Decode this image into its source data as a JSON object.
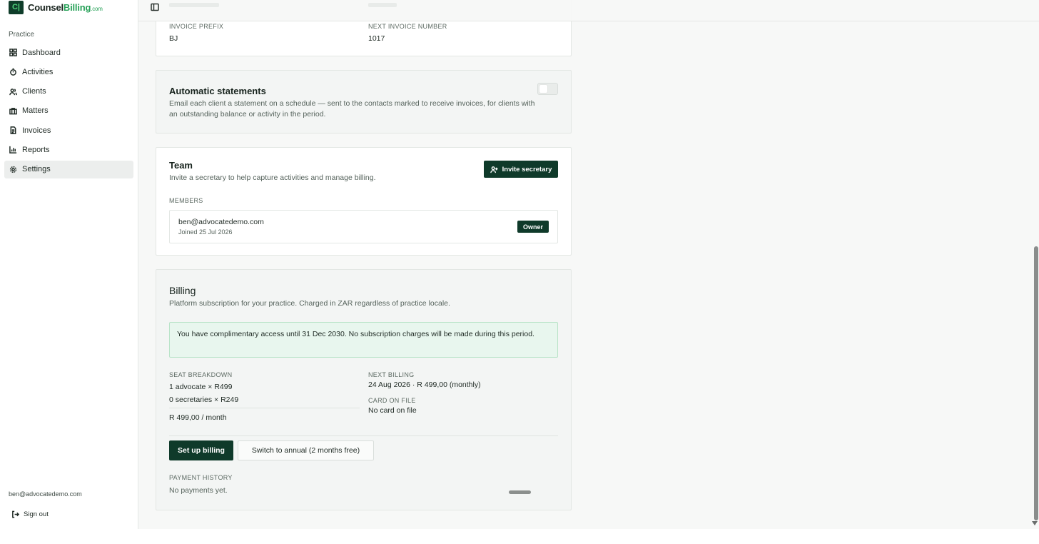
{
  "brand": {
    "logo": "C|",
    "name_main": "Counsel",
    "name_accent": "Billing",
    "name_domain": ".com"
  },
  "sidebar": {
    "section_label": "Practice",
    "items": [
      {
        "label": "Dashboard",
        "icon": "grid-icon"
      },
      {
        "label": "Activities",
        "icon": "timer-icon"
      },
      {
        "label": "Clients",
        "icon": "users-icon"
      },
      {
        "label": "Matters",
        "icon": "briefcase-icon"
      },
      {
        "label": "Invoices",
        "icon": "file-text-icon"
      },
      {
        "label": "Reports",
        "icon": "bar-chart-icon"
      },
      {
        "label": "Settings",
        "icon": "gear-icon"
      }
    ],
    "active": "Settings",
    "user_email": "ben@advocatedemo.com",
    "sign_out": "Sign out"
  },
  "invoice_settings": {
    "prefix_label": "INVOICE PREFIX",
    "prefix_value": "BJ",
    "next_number_label": "NEXT INVOICE NUMBER",
    "next_number_value": "1017"
  },
  "statements": {
    "title": "Automatic statements",
    "description": "Email each client a statement on a schedule — sent to the contacts marked to receive invoices, for clients with an outstanding balance or activity in the period.",
    "enabled": false
  },
  "team": {
    "title": "Team",
    "subtitle": "Invite a secretary to help capture activities and manage billing.",
    "invite_button": "Invite secretary",
    "members_label": "MEMBERS",
    "members": [
      {
        "email": "ben@advocatedemo.com",
        "joined": "Joined 25 Jul 2026",
        "role": "Owner"
      }
    ]
  },
  "billing": {
    "title": "Billing",
    "subtitle": "Platform subscription for your practice. Charged in ZAR regardless of practice locale.",
    "notice": "You have complimentary access until 31 Dec 2030. No subscription charges will be made during this period.",
    "seat_label": "SEAT BREAKDOWN",
    "seat_lines": [
      "1 advocate × R499",
      "0 secretaries × R249"
    ],
    "seat_total": "R 499,00 / month",
    "next_billing_label": "NEXT BILLING",
    "next_billing_value": "24 Aug 2026 · R 499,00 (monthly)",
    "card_label": "CARD ON FILE",
    "card_value": "No card on file",
    "setup_button": "Set up billing",
    "annual_button": "Switch to annual (2 months free)",
    "history_label": "PAYMENT HISTORY",
    "history_empty": "No payments yet."
  },
  "colors": {
    "brand_dark": "#0f3a2a",
    "brand_accent": "#27a158",
    "notice_bg": "#e8f6ee"
  }
}
